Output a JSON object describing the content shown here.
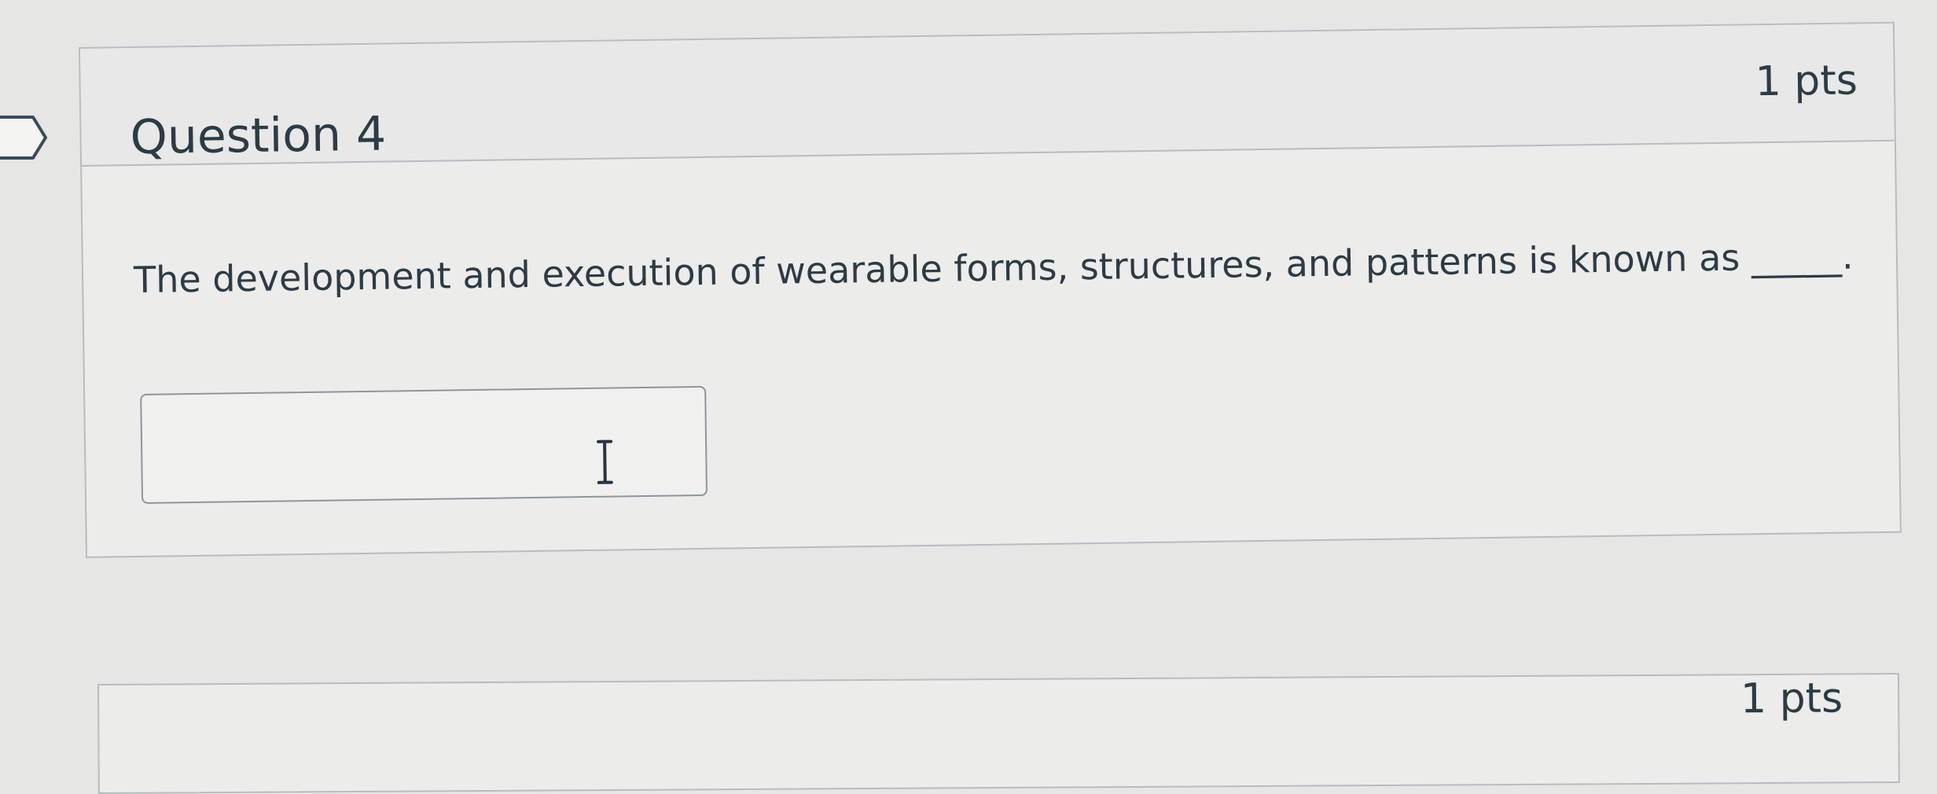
{
  "question": {
    "title": "Question 4",
    "points": "1 pts",
    "text": "The development and execution of wearable forms, structures, and patterns is known as _____.",
    "answer": {
      "value": "",
      "placeholder": ""
    }
  },
  "next_question": {
    "points": "1 pts"
  },
  "icons": {
    "bookmark": "bookmark-flag-icon",
    "cursor": "text-cursor-icon"
  },
  "colors": {
    "text": "#2d3b45",
    "border": "#b8bcbe",
    "background": "#e6e6e4"
  }
}
